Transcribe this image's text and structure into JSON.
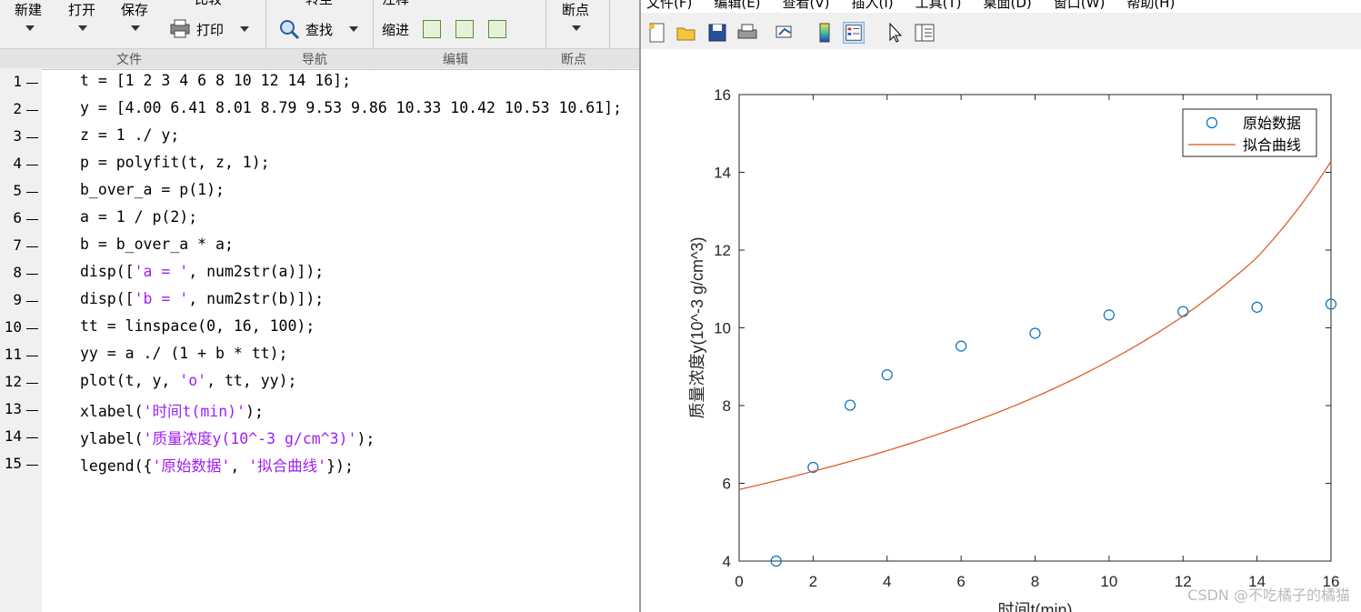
{
  "ribbon": {
    "new_label": "新建",
    "open_label": "打开",
    "save_label": "保存",
    "compare_label": "比较",
    "print_label": "打印",
    "goto_label": "转至",
    "find_label": "查找",
    "insert_label": "注释",
    "indent_label": "缩进",
    "breakpoint_label": "断点",
    "sections": {
      "file": "文件",
      "nav": "导航",
      "edit": "编辑",
      "breakpoint": "断点"
    }
  },
  "code_lines": [
    {
      "n": "1",
      "segs": [
        {
          "t": "t = [1 2 3 4 6 8 10 12 14 16];",
          "s": 0
        }
      ]
    },
    {
      "n": "2",
      "segs": [
        {
          "t": "y = [4.00 6.41 8.01 8.79 9.53 9.86 10.33 10.42 10.53 10.61];",
          "s": 0
        }
      ]
    },
    {
      "n": "3",
      "segs": [
        {
          "t": "z = 1 ./ y;",
          "s": 0
        }
      ]
    },
    {
      "n": "4",
      "segs": [
        {
          "t": "p = polyfit(t, z, 1);",
          "s": 0
        }
      ]
    },
    {
      "n": "5",
      "segs": [
        {
          "t": "b_over_a = p(1);",
          "s": 0
        }
      ]
    },
    {
      "n": "6",
      "segs": [
        {
          "t": "a = 1 / p(2);",
          "s": 0
        }
      ]
    },
    {
      "n": "7",
      "segs": [
        {
          "t": "b = b_over_a * a;",
          "s": 0
        }
      ]
    },
    {
      "n": "8",
      "segs": [
        {
          "t": "disp([",
          "s": 0
        },
        {
          "t": "'a = '",
          "s": 1
        },
        {
          "t": ", num2str(a)]);",
          "s": 0
        }
      ]
    },
    {
      "n": "9",
      "segs": [
        {
          "t": "disp([",
          "s": 0
        },
        {
          "t": "'b = '",
          "s": 1
        },
        {
          "t": ", num2str(b)]);",
          "s": 0
        }
      ]
    },
    {
      "n": "10",
      "segs": [
        {
          "t": "tt = linspace(0, 16, 100);",
          "s": 0
        }
      ]
    },
    {
      "n": "11",
      "segs": [
        {
          "t": "yy = a ./ (1 + b * tt);",
          "s": 0
        }
      ]
    },
    {
      "n": "12",
      "segs": [
        {
          "t": "plot(t, y, ",
          "s": 0
        },
        {
          "t": "'o'",
          "s": 1
        },
        {
          "t": ", tt, yy);",
          "s": 0
        }
      ]
    },
    {
      "n": "13",
      "segs": [
        {
          "t": "xlabel(",
          "s": 0
        },
        {
          "t": "'时间t(min)'",
          "s": 1
        },
        {
          "t": ");",
          "s": 0
        }
      ]
    },
    {
      "n": "14",
      "segs": [
        {
          "t": "ylabel(",
          "s": 0
        },
        {
          "t": "'质量浓度y(10^-3 g/cm^3)'",
          "s": 1
        },
        {
          "t": ");",
          "s": 0
        }
      ]
    },
    {
      "n": "15",
      "segs": [
        {
          "t": "legend({",
          "s": 0
        },
        {
          "t": "'原始数据'",
          "s": 1
        },
        {
          "t": ", ",
          "s": 0
        },
        {
          "t": "'拟合曲线'",
          "s": 1
        },
        {
          "t": "});",
          "s": 0
        }
      ]
    }
  ],
  "figure": {
    "menu": [
      "文件(F)",
      "编辑(E)",
      "查看(V)",
      "插入(I)",
      "工具(T)",
      "桌面(D)",
      "窗口(W)",
      "帮助(H)"
    ],
    "toolbar_icons": [
      "new-figure-icon",
      "open-file-icon",
      "save-icon",
      "print-icon",
      "link-icon",
      "colorbar-icon",
      "legend-icon",
      "pointer-icon",
      "property-editor-icon"
    ]
  },
  "chart_data": {
    "type": "scatter",
    "xlabel": "时间t(min)",
    "ylabel": "质量浓度y(10^-3 g/cm^3)",
    "xlim": [
      0,
      16
    ],
    "ylim": [
      4,
      16
    ],
    "xticks": [
      0,
      2,
      4,
      6,
      8,
      10,
      12,
      14,
      16
    ],
    "yticks": [
      4,
      6,
      8,
      10,
      12,
      14,
      16
    ],
    "grid": false,
    "legend_position": "top-right",
    "series": [
      {
        "name": "原始数据",
        "kind": "markers",
        "color": "#0072bd",
        "x": [
          1,
          2,
          3,
          4,
          6,
          8,
          10,
          12,
          14,
          16
        ],
        "y": [
          4.0,
          6.41,
          8.01,
          8.79,
          9.53,
          9.86,
          10.33,
          10.42,
          10.53,
          10.61
        ]
      },
      {
        "name": "拟合曲线",
        "kind": "line",
        "color": "#d95319",
        "x": [
          0,
          2,
          4,
          6,
          8,
          10,
          12,
          14,
          16
        ],
        "y": [
          5.84,
          6.31,
          6.84,
          7.47,
          8.22,
          9.15,
          10.3,
          11.81,
          14.28
        ]
      }
    ]
  },
  "watermark": "CSDN @不吃橘子的橘猫"
}
